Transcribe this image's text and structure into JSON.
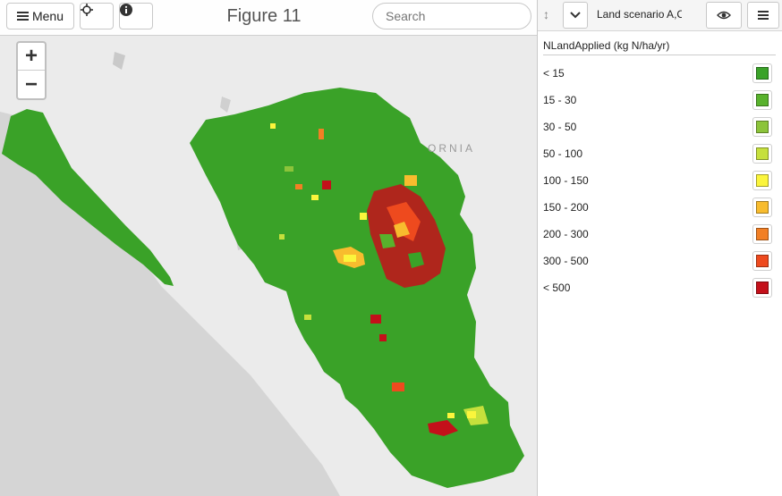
{
  "toolbar": {
    "menu_label": "Menu",
    "title": "Figure 11",
    "search_placeholder": "Search"
  },
  "zoom": {
    "in_label": "+",
    "out_label": "−"
  },
  "map": {
    "place_label": "ORNIA"
  },
  "panel": {
    "layer_name": "Land scenario A,C",
    "legend_title": "NLandApplied (kg N/ha/yr)",
    "legend": [
      {
        "label": "< 15",
        "color": "#3aa228"
      },
      {
        "label": "15 - 30",
        "color": "#58b22c"
      },
      {
        "label": "30 - 50",
        "color": "#8cc43a"
      },
      {
        "label": "50 - 100",
        "color": "#c6e03c"
      },
      {
        "label": "100 - 150",
        "color": "#fbf53c"
      },
      {
        "label": "150 - 200",
        "color": "#f8bc2e"
      },
      {
        "label": "200 - 300",
        "color": "#f27f24"
      },
      {
        "label": "300 - 500",
        "color": "#ee4a1e"
      },
      {
        "label": "< 500",
        "color": "#c4101a"
      }
    ]
  },
  "icons": {
    "menu": "menu-icon",
    "locate": "crosshair-icon",
    "info": "info-icon",
    "drag": "drag-handle-icon",
    "collapse": "chevron-down-icon",
    "visibility": "eye-icon",
    "layer_menu": "list-icon"
  }
}
